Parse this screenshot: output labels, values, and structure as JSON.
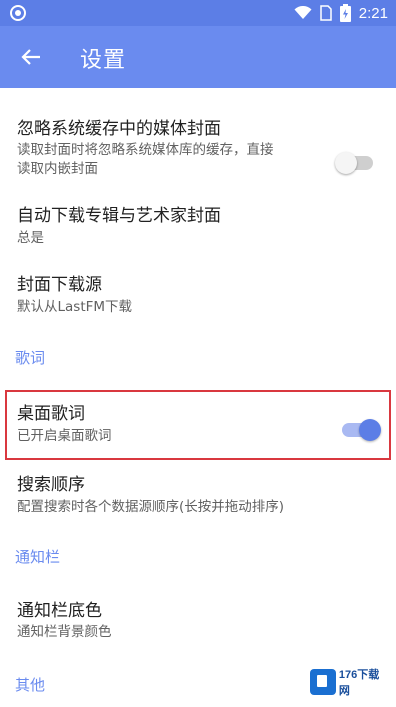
{
  "status_bar": {
    "time": "2:21",
    "icons": [
      "app-notification-icon",
      "wifi-icon",
      "sim-icon",
      "battery-charging-icon"
    ]
  },
  "app_bar": {
    "title": "设置",
    "back_icon": "arrow-left-icon"
  },
  "settings": [
    {
      "title": "忽略系统缓存中的媒体封面",
      "summary_line1": "读取封面时将忽略系统媒体库的缓存，直接",
      "summary_line2": "读取内嵌封面",
      "toggle": "off"
    },
    {
      "title": "自动下载专辑与艺术家封面",
      "summary": "总是"
    },
    {
      "title": "封面下载源",
      "summary": "默认从LastFM下载"
    }
  ],
  "section_lyrics": "歌词",
  "desktop_lyrics": {
    "title": "桌面歌词",
    "summary": "已开启桌面歌词",
    "toggle": "on"
  },
  "search_order": {
    "title": "搜索顺序",
    "summary": "配置搜索时各个数据源顺序(长按并拖动排序)"
  },
  "section_notification": "通知栏",
  "notification_bg": {
    "title": "通知栏底色",
    "summary": "通知栏背景颜色"
  },
  "section_other": "其他",
  "watermark": {
    "text": "176下载网"
  },
  "colors": {
    "accent": "#6a8bef",
    "status_bar": "#5c7ee6",
    "highlight": "#d9383f"
  }
}
